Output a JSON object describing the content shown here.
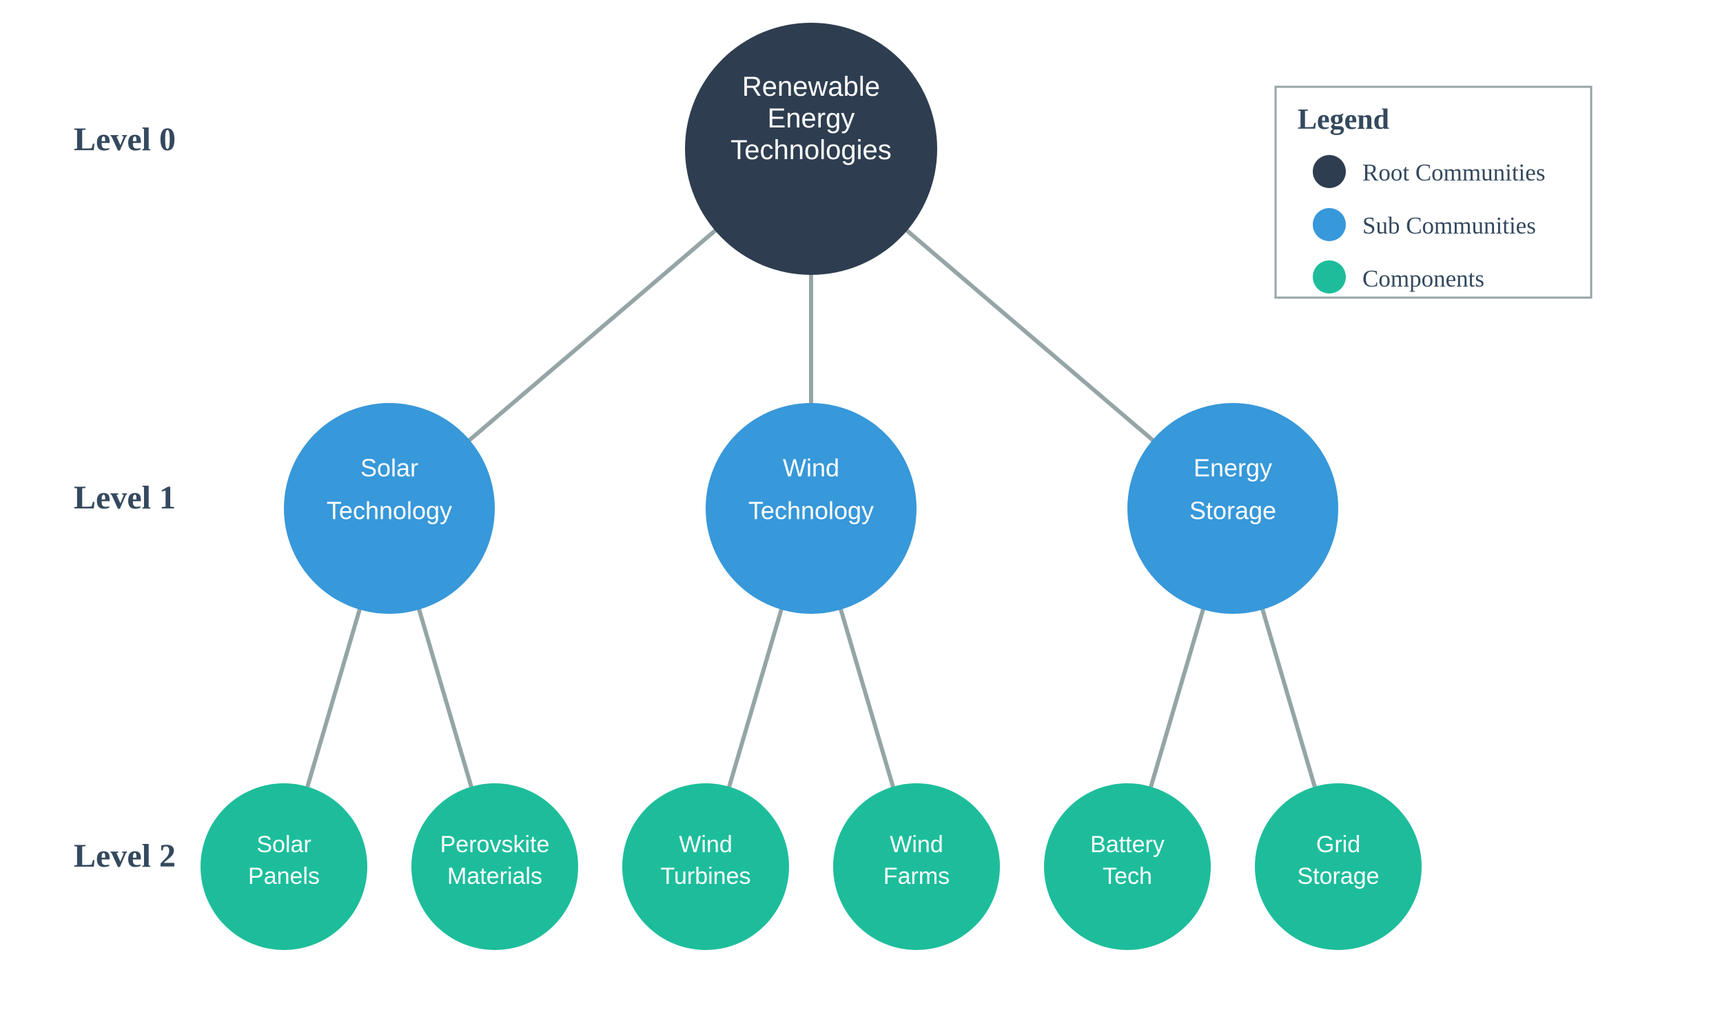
{
  "colors": {
    "root": "#2e3e50",
    "sub": "#3798da",
    "component": "#1dbd9b",
    "edge": "#95a5a6",
    "text_dark": "#34495e",
    "legend_border": "#95a5a6"
  },
  "levels": [
    {
      "label": "Level 0"
    },
    {
      "label": "Level 1"
    },
    {
      "label": "Level 2"
    }
  ],
  "nodes": [
    {
      "id": "root",
      "type": "root",
      "level": 0,
      "lines": [
        "Renewable",
        "Energy",
        "Technologies"
      ]
    },
    {
      "id": "solar-technology",
      "type": "sub",
      "level": 1,
      "parent": "root",
      "lines": [
        "Solar",
        "Technology"
      ]
    },
    {
      "id": "wind-technology",
      "type": "sub",
      "level": 1,
      "parent": "root",
      "lines": [
        "Wind",
        "Technology"
      ]
    },
    {
      "id": "energy-storage",
      "type": "sub",
      "level": 1,
      "parent": "root",
      "lines": [
        "Energy",
        "Storage"
      ]
    },
    {
      "id": "solar-panels",
      "type": "component",
      "level": 2,
      "parent": "solar-technology",
      "lines": [
        "Solar",
        "Panels"
      ]
    },
    {
      "id": "perovskite-materials",
      "type": "component",
      "level": 2,
      "parent": "solar-technology",
      "lines": [
        "Perovskite",
        "Materials"
      ]
    },
    {
      "id": "wind-turbines",
      "type": "component",
      "level": 2,
      "parent": "wind-technology",
      "lines": [
        "Wind",
        "Turbines"
      ]
    },
    {
      "id": "wind-farms",
      "type": "component",
      "level": 2,
      "parent": "wind-technology",
      "lines": [
        "Wind",
        "Farms"
      ]
    },
    {
      "id": "battery-tech",
      "type": "component",
      "level": 2,
      "parent": "energy-storage",
      "lines": [
        "Battery",
        "Tech"
      ]
    },
    {
      "id": "grid-storage",
      "type": "component",
      "level": 2,
      "parent": "energy-storage",
      "lines": [
        "Grid",
        "Storage"
      ]
    }
  ],
  "legend": {
    "title": "Legend",
    "items": [
      {
        "label": "Root Communities",
        "type": "root"
      },
      {
        "label": "Sub Communities",
        "type": "sub"
      },
      {
        "label": "Components",
        "type": "component"
      }
    ]
  }
}
